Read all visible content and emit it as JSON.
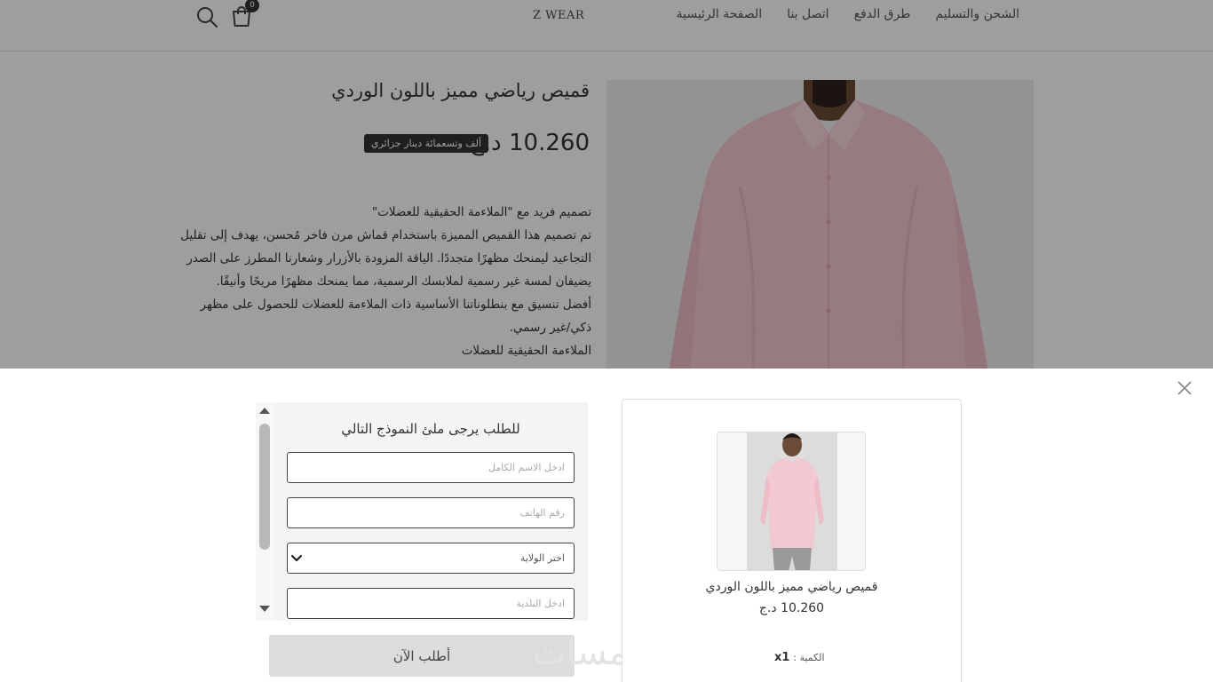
{
  "header": {
    "brand": "Z WEAR",
    "nav": [
      "الصفحة الرئيسية",
      "اتصل بنا",
      "طرق الدفع",
      "الشحن والتسليم"
    ],
    "cart_count": "0"
  },
  "product": {
    "title": "قميص رياضي مميز باللون الوردي",
    "price": "10.260 د.ج",
    "price_words": "ألف وتسعمائة دينار جزائري",
    "description": [
      "تصميم فريد مع \"الملاءمة الحقيقية للعضلات\"",
      "تم تصميم هذا القميص المميزة باستخدام قماش مرن فاخر مُحسن، يهدف إلى تقليل",
      "التجاعيد ليمنحك مظهرًا متجددًا. الياقة المزودة بالأزرار وشعارنا المطرز على الصدر",
      "يضيفان لمسة غير رسمية لملابسك الرسمية، مما يمنحك مظهرًا مريحًا وأنيقًا.",
      "أفضل تنسيق مع بنطلوناتنا الأساسية ذات الملاءمة للعضلات للحصول على مظهر",
      "ذكي/غير رسمي.",
      "الملاءمة الحقيقية للعضلات"
    ]
  },
  "order_form": {
    "title": "للطلب يرجى ملئ النموذج التالي",
    "name_placeholder": "ادخل الاسم الكامل",
    "phone_placeholder": "رقم الهاتف",
    "state_selected": "اختر الولاية",
    "city_placeholder": "ادخل البلدية",
    "submit_label": "أطلب الآن"
  },
  "cart_summary": {
    "name": "قميص رياضي مميز باللون الوردي",
    "price": "10.260 د.ج",
    "qty_label": "الكمية :",
    "qty_value": "x1"
  },
  "watermark": "خمسات",
  "colors": {
    "shirt": "#f3c9d1",
    "dark": "#333333",
    "overlay": "rgba(0,0,0,0.38)"
  }
}
